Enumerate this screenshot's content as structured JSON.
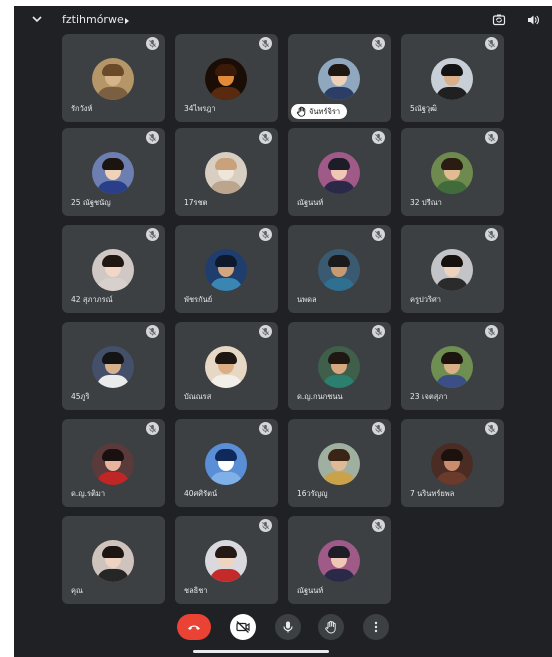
{
  "meeting": {
    "title": "fztihmórwe"
  },
  "participants": [
    {
      "name": "รักวังห์",
      "hand_raised": false,
      "muted": true,
      "avatar": {
        "bg": "#b59669",
        "skin": "#d8b48a",
        "hair": "#6b4a2a",
        "shirt": "#7a6040"
      }
    },
    {
      "name": "34ไพรฎา",
      "hand_raised": false,
      "muted": true,
      "avatar": {
        "bg": "#1a0d05",
        "skin": "#e08a3a",
        "hair": "#3a1a08",
        "shirt": "#5a2a0e"
      }
    },
    {
      "name": "จันทร์จิรา",
      "hand_raised": true,
      "muted": true,
      "avatar": {
        "bg": "#8fa7bf",
        "skin": "#eed0b6",
        "hair": "#1f1712",
        "shirt": "#2c3e66"
      }
    },
    {
      "name": "5ณัฐวุฒิ",
      "hand_raised": false,
      "muted": true,
      "avatar": {
        "bg": "#c9cfd6",
        "skin": "#d9b08a",
        "hair": "#141414",
        "shirt": "#202020"
      }
    },
    {
      "name": "25 ณัฐชนัญ",
      "hand_raised": false,
      "muted": true,
      "avatar": {
        "bg": "#6d7fb0",
        "skin": "#f0d2b8",
        "hair": "#1b1411",
        "shirt": "#2a3e8a"
      }
    },
    {
      "name": "17รชต",
      "hand_raised": false,
      "muted": true,
      "avatar": {
        "bg": "#d8cfc2",
        "skin": "#efe6da",
        "hair": "#c9a27c",
        "shirt": "#bba58c"
      }
    },
    {
      "name": "ณัฐนนท์",
      "hand_raised": false,
      "muted": true,
      "avatar": {
        "bg": "#a05a88",
        "skin": "#f0c6b4",
        "hair": "#1d1d28",
        "shirt": "#2a2a48"
      }
    },
    {
      "name": "32 ปรีณา",
      "hand_raised": false,
      "muted": true,
      "avatar": {
        "bg": "#6f8a4e",
        "skin": "#e2bb92",
        "hair": "#2a1c12",
        "shirt": "#3f6c3a"
      }
    },
    {
      "name": "42 สุภาภรณ์",
      "hand_raised": false,
      "muted": true,
      "avatar": {
        "bg": "#cfc8c4",
        "skin": "#f2d6c6",
        "hair": "#201713",
        "shirt": "#d7d0cc"
      }
    },
    {
      "name": "พัชรกันย์",
      "hand_raised": false,
      "muted": true,
      "avatar": {
        "bg": "#1f3e6e",
        "skin": "#d3a680",
        "hair": "#0e1a2c",
        "shirt": "#3a86b2"
      }
    },
    {
      "name": "นพดล",
      "hand_raised": false,
      "muted": true,
      "avatar": {
        "bg": "#3a5a72",
        "skin": "#c99a72",
        "hair": "#1a1a1a",
        "shirt": "#2f6f8f"
      }
    },
    {
      "name": "ครูปวริศา",
      "hand_raised": false,
      "muted": true,
      "avatar": {
        "bg": "#c2c4c8",
        "skin": "#f0d3bd",
        "hair": "#16110e",
        "shirt": "#2b2b2b"
      }
    },
    {
      "name": "45ภูริ",
      "hand_raised": false,
      "muted": true,
      "avatar": {
        "bg": "#44506a",
        "skin": "#d7b08c",
        "hair": "#141414",
        "shirt": "#ebebeb"
      }
    },
    {
      "name": "บัณณรส",
      "hand_raised": false,
      "muted": true,
      "avatar": {
        "bg": "#e7d8c6",
        "skin": "#dcae86",
        "hair": "#1e1612",
        "shirt": "#f2efe8"
      }
    },
    {
      "name": "ด.ญ.กนกชนน",
      "hand_raised": false,
      "muted": true,
      "avatar": {
        "bg": "#3f5f4a",
        "skin": "#d7a880",
        "hair": "#1f1712",
        "shirt": "#2a7f6f"
      }
    },
    {
      "name": "23 เจตสุภา",
      "hand_raised": false,
      "muted": true,
      "avatar": {
        "bg": "#6f8f52",
        "skin": "#d9b088",
        "hair": "#1d1410",
        "shirt": "#3b4f86"
      }
    },
    {
      "name": "ด.ญ.รติมา",
      "hand_raised": false,
      "muted": true,
      "avatar": {
        "bg": "#5a3a3a",
        "skin": "#e8b49c",
        "hair": "#1a1010",
        "shirt": "#c02626"
      }
    },
    {
      "name": "40ศศิรัตน์",
      "hand_raised": false,
      "muted": true,
      "avatar": {
        "bg": "#5a8fd8",
        "skin": "#ffffff",
        "hair": "#0f2a5a",
        "shirt": "#7fb0e8"
      }
    },
    {
      "name": "16วรัญญู",
      "hand_raised": false,
      "muted": true,
      "avatar": {
        "bg": "#9fb0a0",
        "skin": "#e0ba96",
        "hair": "#3a2416",
        "shirt": "#c9a24a"
      }
    },
    {
      "name": "7 นรินทร์ยพล",
      "hand_raised": false,
      "muted": true,
      "avatar": {
        "bg": "#4a2c24",
        "skin": "#c98d6c",
        "hair": "#1c110c",
        "shirt": "#6a3a2a"
      }
    },
    {
      "name": "คุณ",
      "hand_raised": false,
      "muted": false,
      "avatar": {
        "bg": "#cfc4bd",
        "skin": "#efd2c0",
        "hair": "#1d1512",
        "shirt": "#262626"
      }
    },
    {
      "name": "ชลธิชา",
      "hand_raised": false,
      "muted": true,
      "avatar": {
        "bg": "#d9d9de",
        "skin": "#efd4c0",
        "hair": "#241915",
        "shirt": "#c42a2a"
      }
    },
    {
      "name": "ณัฐนนท์",
      "hand_raised": false,
      "muted": true,
      "avatar": {
        "bg": "#a05a88",
        "skin": "#f0c6b4",
        "hair": "#1d1d28",
        "shirt": "#2a2a48"
      }
    }
  ],
  "colors": {
    "background": "#202124",
    "tile": "#3c4043",
    "leave_button": "#ea4335",
    "text": "#e8eaed"
  },
  "icons": {
    "topbar": [
      "chevron-down-icon",
      "camera-switch-icon",
      "speaker-icon"
    ],
    "tile": [
      "mic-off-icon",
      "raised-hand-icon"
    ],
    "controls": [
      "call-end-icon",
      "camera-off-icon",
      "mic-icon",
      "raise-hand-icon",
      "more-vert-icon"
    ]
  }
}
